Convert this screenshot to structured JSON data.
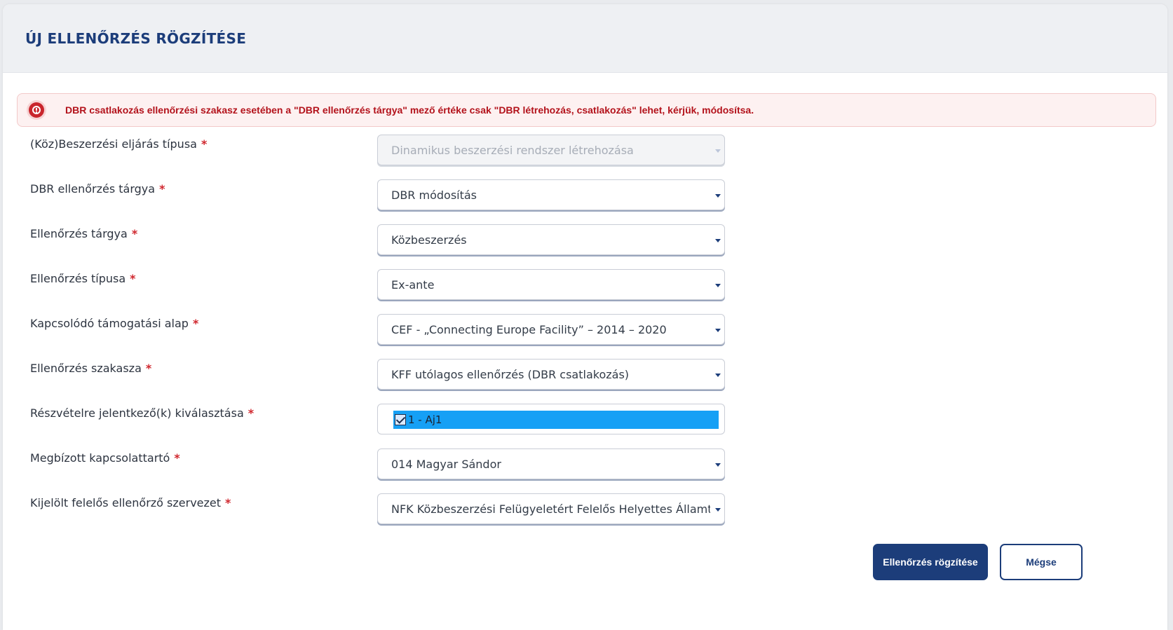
{
  "header": {
    "title": "ÚJ ELLENŐRZÉS RÖGZÍTÉSE"
  },
  "alert": {
    "icon": "error-icon",
    "text": "DBR csatlakozás ellenőrzési szakasz esetében a \"DBR ellenőrzés tárgya\" mező értéke csak \"DBR létrehozás, csatlakozás\" lehet, kérjük, módosítsa."
  },
  "form": {
    "required_mark": "*",
    "fields": [
      {
        "label": "(Köz)Beszerzési eljárás típusa",
        "value": "Dinamikus beszerzési rendszer létrehozása",
        "disabled": true
      },
      {
        "label": "DBR ellenőrzés tárgya",
        "value": "DBR módosítás"
      },
      {
        "label": "Ellenőrzés tárgya",
        "value": "Közbeszerzés"
      },
      {
        "label": "Ellenőrzés típusa",
        "value": "Ex-ante"
      },
      {
        "label": "Kapcsolódó támogatási alap",
        "value": "CEF - „Connecting Europe Facility” – 2014 – 2020"
      },
      {
        "label": "Ellenőrzés szakasza",
        "value": "KFF utólagos ellenőrzés (DBR csatlakozás)"
      },
      {
        "label": "Részvételre jelentkező(k) kiválasztása",
        "option": "1 - Aj1",
        "checked": true
      },
      {
        "label": "Megbízott kapcsolattartó",
        "value": "014 Magyar Sándor"
      },
      {
        "label": "Kijelölt felelős ellenőrző szervezet",
        "value": "NFK Közbeszerzési Felügyeletért Felelős Helyettes Államtitkárság"
      }
    ]
  },
  "actions": {
    "submit_label": "Ellenőrzés rögzítése",
    "cancel_label": "Mégse"
  },
  "colors": {
    "primary": "#1c3d7a",
    "error": "#b3121b",
    "required": "#d0262d",
    "selection": "#16a0f5"
  }
}
